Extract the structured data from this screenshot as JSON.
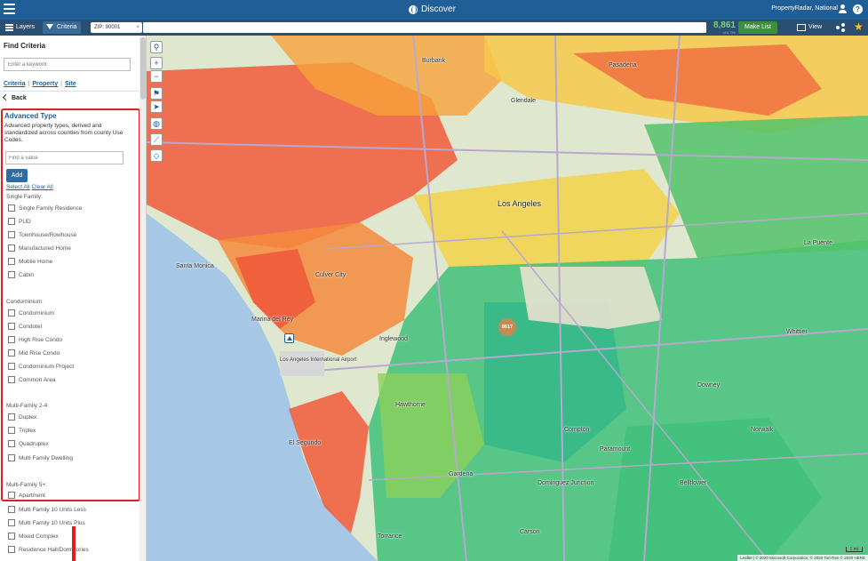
{
  "topbar": {
    "title": "Discover",
    "account": "PropertyRadar, National",
    "help": "?"
  },
  "subbar": {
    "tab_layers": "Layers",
    "tab_criteria": "Criteria",
    "zip_chip": "ZIP: 90001",
    "zip_close": "×",
    "count": "8,861",
    "count_sub": "of 6,789",
    "make_list": "Make List",
    "view": "View",
    "star": "★"
  },
  "sidebar": {
    "title": "Find Criteria",
    "keyword_placeholder": "Enter a keyword",
    "links": [
      "Criteria",
      "Property",
      "Site"
    ],
    "back": "Back",
    "advanced": {
      "title": "Advanced Type",
      "description": "Advanced property types, derived and standardized across counties from county Use Codes.",
      "find_placeholder": "Find a value",
      "add": "Add",
      "select_all": "Select All",
      "clear_all": "Clear All"
    },
    "groups": [
      {
        "label": "Single Family:",
        "items": [
          "Single Family Residence",
          "PUD",
          "Townhouse/Rowhouse",
          "Manufactured Home",
          "Mobile Home",
          "Cabin"
        ]
      },
      {
        "label": "Condominium:",
        "items": [
          "Condominium",
          "Condotel",
          "High Rise Condo",
          "Mid Rise Condo",
          "Condominium Project",
          "Common Area"
        ]
      },
      {
        "label": "Multi-Family 2-4:",
        "items": [
          "Duplex",
          "Triplex",
          "Quadruplex",
          "Multi Family Dwelling"
        ]
      },
      {
        "label": "Multi-Family 5+:",
        "items": [
          "Apartment",
          "Multi Family 10 Units Less",
          "Multi Family 10 Units Plus",
          "Mixed Complex",
          "Residence Hall/Dormitories"
        ]
      }
    ]
  },
  "map": {
    "cluster": "8617",
    "labels": {
      "los_angeles": "Los Angeles",
      "santa_monica": "Santa Monica",
      "culver_city": "Culver City",
      "marina_del_rey": "Marina del Rey",
      "hawthorne": "Hawthorne",
      "inglewood": "Inglewood",
      "lax": "Los Angeles International Airport",
      "el_segundo": "El Segundo",
      "torrance": "Torrance",
      "compton": "Compton",
      "downey": "Downey",
      "paramount": "Paramount",
      "dominguez": "Dominguez Junction",
      "pasadena": "Pasadena",
      "glendale": "Glendale",
      "burbank": "Burbank",
      "la_puente": "La Puente",
      "whittier": "Whittier",
      "norwalk": "Norwalk",
      "bellflower": "Bellflower",
      "gardena": "Gardena",
      "carson": "Carson"
    },
    "scale": "1 mi",
    "attribution": "Leaflet | © 2020 Microsoft Corporation, © 2020 TomTom © 2020 HERE"
  }
}
